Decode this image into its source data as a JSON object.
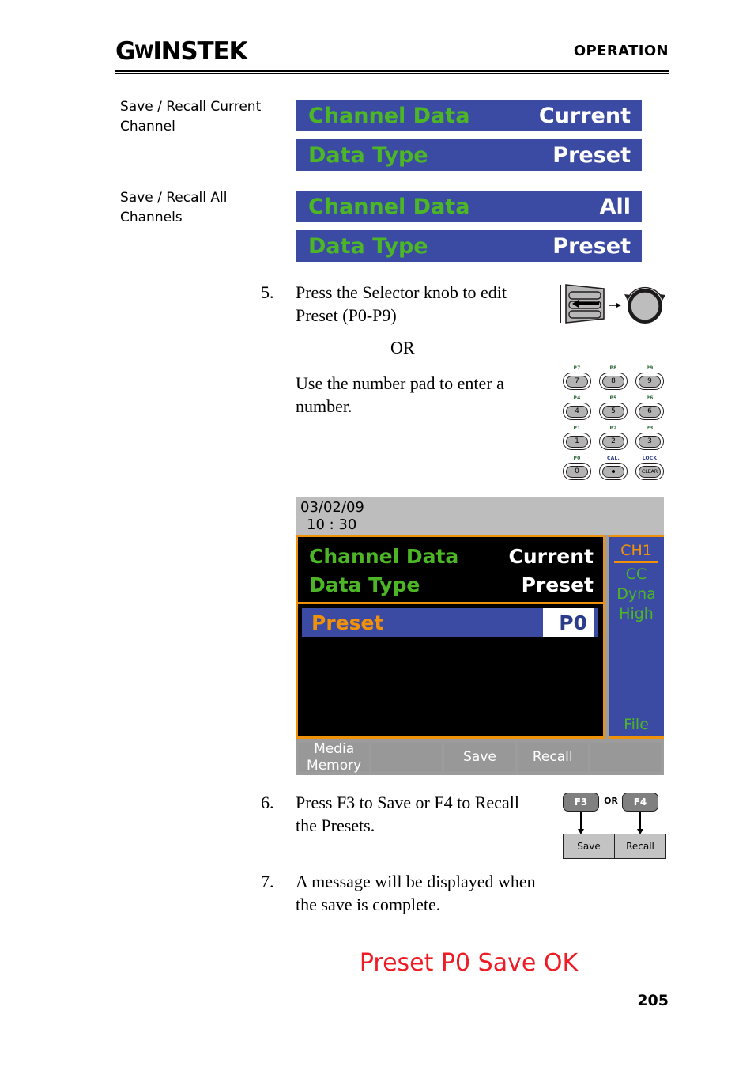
{
  "header": {
    "logo": "G INSTEK",
    "logo_prefix": "G",
    "logo_mid": "W",
    "logo_suffix": "INSTEK",
    "title": "OPERATION"
  },
  "side_labels": {
    "one": "Save / Recall Current Channel",
    "two": "Save / Recall All Channels"
  },
  "banners": [
    {
      "key": "Channel Data",
      "value": "Current"
    },
    {
      "key": "Data Type",
      "value": "Preset"
    },
    {
      "key": "Channel Data",
      "value": "All"
    },
    {
      "key": "Data Type",
      "value": "Preset"
    }
  ],
  "steps": {
    "five": {
      "number": "5.",
      "text": "Press the Selector knob to edit Preset (P0-P9)"
    },
    "or": "OR",
    "numpad_text": "Use the number pad to enter a number.",
    "six": {
      "number": "6.",
      "text": "Press F3 to Save or F4 to Recall the Presets."
    },
    "seven": {
      "number": "7.",
      "text": "A message will be displayed when the save is complete."
    }
  },
  "numpad": {
    "keys": [
      {
        "top": "P7",
        "top_color": "green",
        "label": "7"
      },
      {
        "top": "P8",
        "top_color": "green",
        "label": "8"
      },
      {
        "top": "P9",
        "top_color": "green",
        "label": "9"
      },
      {
        "top": "P4",
        "top_color": "green",
        "label": "4"
      },
      {
        "top": "P5",
        "top_color": "green",
        "label": "5"
      },
      {
        "top": "P6",
        "top_color": "green",
        "label": "6"
      },
      {
        "top": "P1",
        "top_color": "green",
        "label": "1"
      },
      {
        "top": "P2",
        "top_color": "green",
        "label": "2"
      },
      {
        "top": "P3",
        "top_color": "green",
        "label": "3"
      },
      {
        "top": "P0",
        "top_color": "green",
        "label": "0"
      },
      {
        "top": "CAL.",
        "top_color": "blue",
        "label": "•"
      },
      {
        "top": "LOCK",
        "top_color": "blue",
        "label": "CLEAR"
      }
    ]
  },
  "lcd": {
    "date": "03/02/09",
    "time": "10 : 30",
    "rows": [
      {
        "key": "Channel Data",
        "value": "Current"
      },
      {
        "key": "Data Type",
        "value": "Preset"
      }
    ],
    "preset_row": {
      "key": "Preset",
      "value": "P0"
    },
    "sidebar": {
      "channel": "CH1",
      "mode_1": "CC",
      "mode_2": "Dyna",
      "mode_3": "High",
      "file": "File"
    },
    "softkeys": [
      {
        "top": "Media",
        "bottom": "Memory",
        "stacked": true
      },
      {
        "label": ""
      },
      {
        "label": "Save"
      },
      {
        "label": "Recall"
      },
      {
        "label": ""
      }
    ]
  },
  "fkeys": {
    "f3": "F3",
    "or": "OR",
    "f4": "F4",
    "save": "Save",
    "recall": "Recall"
  },
  "final_message": "Preset P0 Save OK",
  "page_number": "205",
  "colors": {
    "banner_blue": "#3b4aa2",
    "menu_green": "#4cb626",
    "accent_orange": "#f0910a",
    "message_red": "#ee1c25",
    "lcd_gray": "#9c9c9c"
  }
}
